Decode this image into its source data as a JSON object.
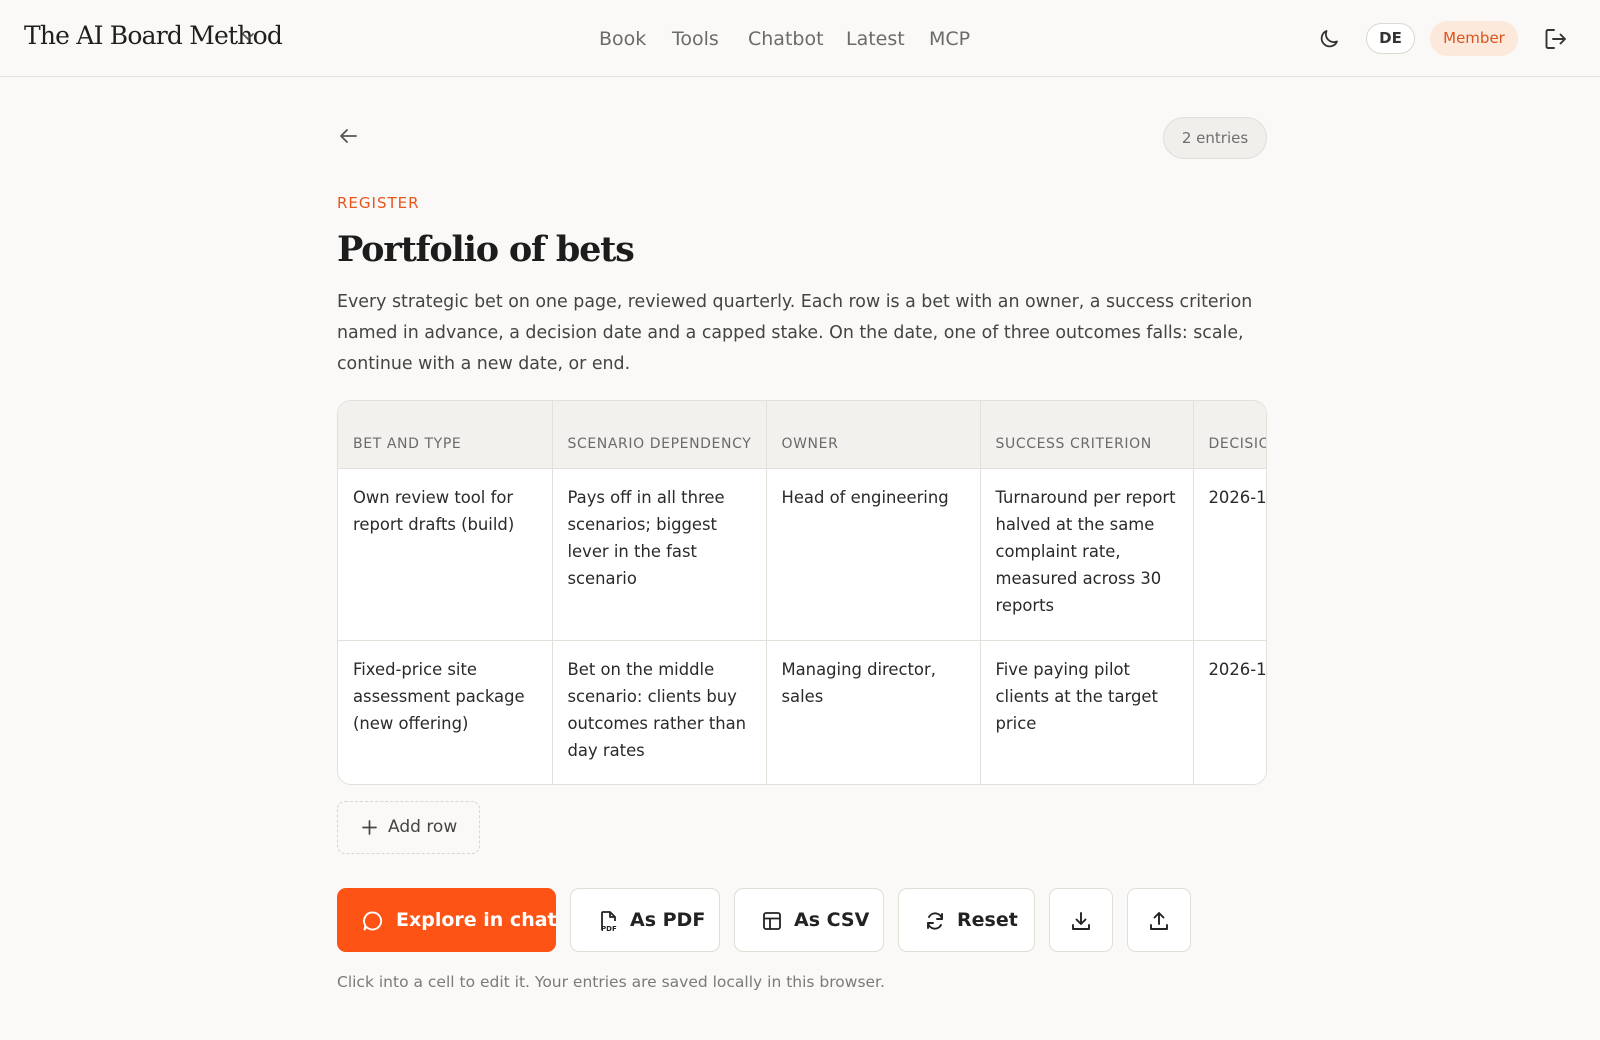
{
  "header": {
    "brand": "The AI Board Method",
    "nav": [
      "Book",
      "Tools",
      "Chatbot",
      "Latest",
      "MCP"
    ],
    "lang": "DE",
    "member": "Member"
  },
  "page": {
    "entries": "2 entries",
    "eyebrow": "REGISTER",
    "title": "Portfolio of bets",
    "description": "Every strategic bet on one page, reviewed quarterly. Each row is a bet with an owner, a success criterion named in advance, a decision date and a capped stake. On the date, one of three outcomes falls: scale, continue with a new date, or end."
  },
  "table": {
    "columns": [
      "BET AND TYPE",
      "SCENARIO DEPENDENCY",
      "OWNER",
      "SUCCESS CRITERION",
      "DECISION"
    ],
    "rows": [
      [
        "Own review tool for report drafts (build)",
        "Pays off in all three scenarios; biggest lever in the fast scenario",
        "Head of engineering",
        "Turnaround per report halved at the same complaint rate, measured across 30 reports",
        "2026-1"
      ],
      [
        "Fixed-price site assessment package (new offering)",
        "Bet on the middle scenario: clients buy outcomes rather than day rates",
        "Managing director, sales",
        "Five paying pilot clients at the target price",
        "2026-1"
      ]
    ]
  },
  "actions": {
    "add_row": "Add row",
    "explore": "Explore in chat",
    "pdf": "As PDF",
    "csv": "As CSV",
    "reset": "Reset"
  },
  "hint": "Click into a cell to edit it. Your entries are saved locally in this browser.",
  "colors": {
    "accent": "#fd5314",
    "member_bg": "#fde8dc",
    "member_text": "#d9541e"
  }
}
